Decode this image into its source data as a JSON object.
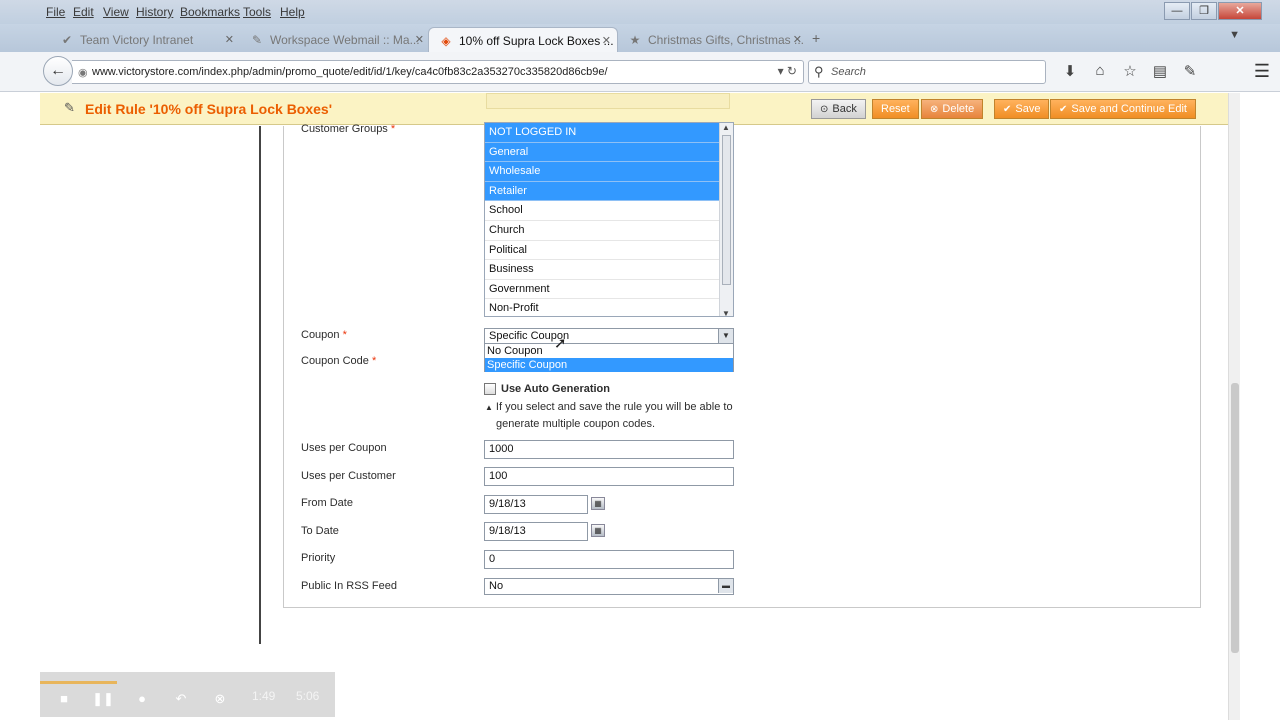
{
  "browser": {
    "menu": [
      "File",
      "Edit",
      "View",
      "History",
      "Bookmarks",
      "Tools",
      "Help"
    ],
    "tabs": [
      {
        "title": "Team Victory Intranet",
        "icon": "✔"
      },
      {
        "title": "Workspace Webmail :: Ma...",
        "icon": "✎"
      },
      {
        "title": "10% off Supra Lock Boxes ...",
        "icon": "◈"
      },
      {
        "title": "Christmas Gifts, Christmas ...",
        "icon": "★"
      }
    ],
    "url": "www.victorystore.com/index.php/admin/promo_quote/edit/id/1/key/ca4c0fb83c2a353270c335820d86cb9e/",
    "search_placeholder": "Search"
  },
  "header": {
    "title": "Edit Rule '10% off Supra Lock Boxes'",
    "buttons": {
      "back": "Back",
      "reset": "Reset",
      "delete": "Delete",
      "save": "Save",
      "save_continue": "Save and Continue Edit"
    }
  },
  "form": {
    "customer_groups": {
      "label": "Customer Groups",
      "options": [
        {
          "label": "NOT LOGGED IN",
          "selected": true
        },
        {
          "label": "General",
          "selected": true
        },
        {
          "label": "Wholesale",
          "selected": true
        },
        {
          "label": "Retailer",
          "selected": true
        },
        {
          "label": "School",
          "selected": false
        },
        {
          "label": "Church",
          "selected": false
        },
        {
          "label": "Political",
          "selected": false
        },
        {
          "label": "Business",
          "selected": false
        },
        {
          "label": "Government",
          "selected": false
        },
        {
          "label": "Non-Profit",
          "selected": false
        }
      ]
    },
    "coupon": {
      "label": "Coupon",
      "value": "Specific Coupon",
      "options": [
        "No Coupon",
        "Specific Coupon"
      ]
    },
    "coupon_code": {
      "label": "Coupon Code"
    },
    "auto_generation": {
      "label": "Use Auto Generation",
      "note_line1": "If you select and save the rule you will be able to",
      "note_line2": "generate multiple coupon codes."
    },
    "uses_per_coupon": {
      "label": "Uses per Coupon",
      "value": "1000"
    },
    "uses_per_customer": {
      "label": "Uses per Customer",
      "value": "100"
    },
    "from_date": {
      "label": "From Date",
      "value": "9/18/13"
    },
    "to_date": {
      "label": "To Date",
      "value": "9/18/13"
    },
    "priority": {
      "label": "Priority",
      "value": "0"
    },
    "rss": {
      "label": "Public In RSS Feed",
      "value": "No"
    }
  },
  "video": {
    "progress": 0.26,
    "elapsed": "1:49",
    "total": "5:06"
  }
}
